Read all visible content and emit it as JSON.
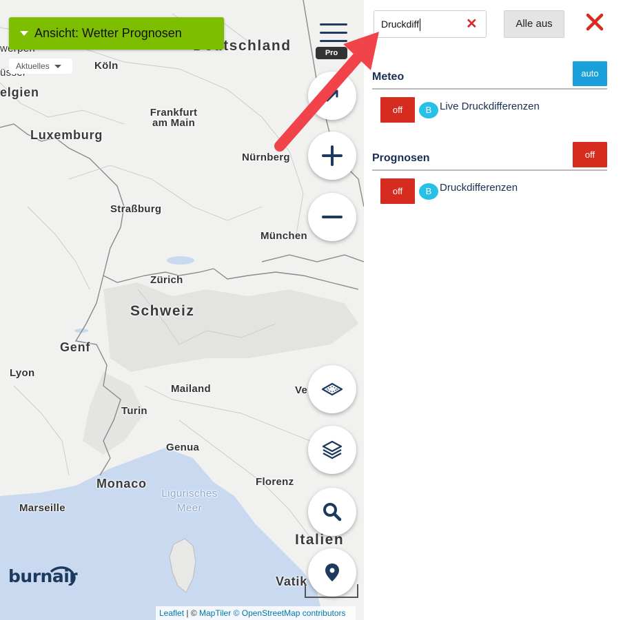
{
  "map": {
    "view_button": "Ansicht: Wetter Prognosen",
    "current_dropdown": "Aktuelles",
    "pro_badge": "Pro",
    "cities": {
      "deutschland": "Deutschland",
      "koeln": "Köln",
      "belgien": "elgien",
      "antwerpen": "werpen",
      "bruessel": "üssel",
      "frankfurt": "Frankfurt am Main",
      "luxemburg": "Luxemburg",
      "nuernberg": "Nürnberg",
      "strassburg": "Straßburg",
      "muenchen": "München",
      "zuerich": "Zürich",
      "schweiz": "Schweiz",
      "genf": "Genf",
      "lyon": "Lyon",
      "mailand": "Mailand",
      "venedig": "Ve",
      "turin": "Turin",
      "genua": "Genua",
      "monaco": "Monaco",
      "florenz": "Florenz",
      "ligurisches_meer": "Ligurisches Meer",
      "marseille": "Marseille",
      "italien": "Italien",
      "vatikan": "Vatik"
    },
    "logo": "burnair",
    "attribution": {
      "leaflet": "Leaflet",
      "sep": " | © ",
      "maptiler": "MapTiler",
      "osm": "© OpenStreetMap contributors"
    },
    "controls": [
      "locate-icon",
      "zoom-in-icon",
      "zoom-out-icon",
      "layer-outline-icon",
      "layers-icon",
      "search-icon",
      "location-pin-icon"
    ]
  },
  "panel": {
    "search": {
      "value": "Druckdiff",
      "clear_icon": "✕"
    },
    "all_off": "Alle aus",
    "sections": [
      {
        "title": "Meteo",
        "toggle": "auto",
        "items": [
          {
            "state": "off",
            "badge": "B",
            "label": "Live Druckdifferenzen"
          }
        ]
      },
      {
        "title": "Prognosen",
        "toggle": "off",
        "items": [
          {
            "state": "off",
            "badge": "B",
            "label": "Druckdifferenzen"
          }
        ]
      }
    ]
  },
  "colors": {
    "view_button": "#7ebe00",
    "off_red": "#d62b1f",
    "auto_blue": "#1aa1db",
    "badge_cyan": "#27c0e6",
    "navy": "#1a2e52",
    "arrow_red": "#f0434a",
    "water": "#c9d9f0"
  }
}
